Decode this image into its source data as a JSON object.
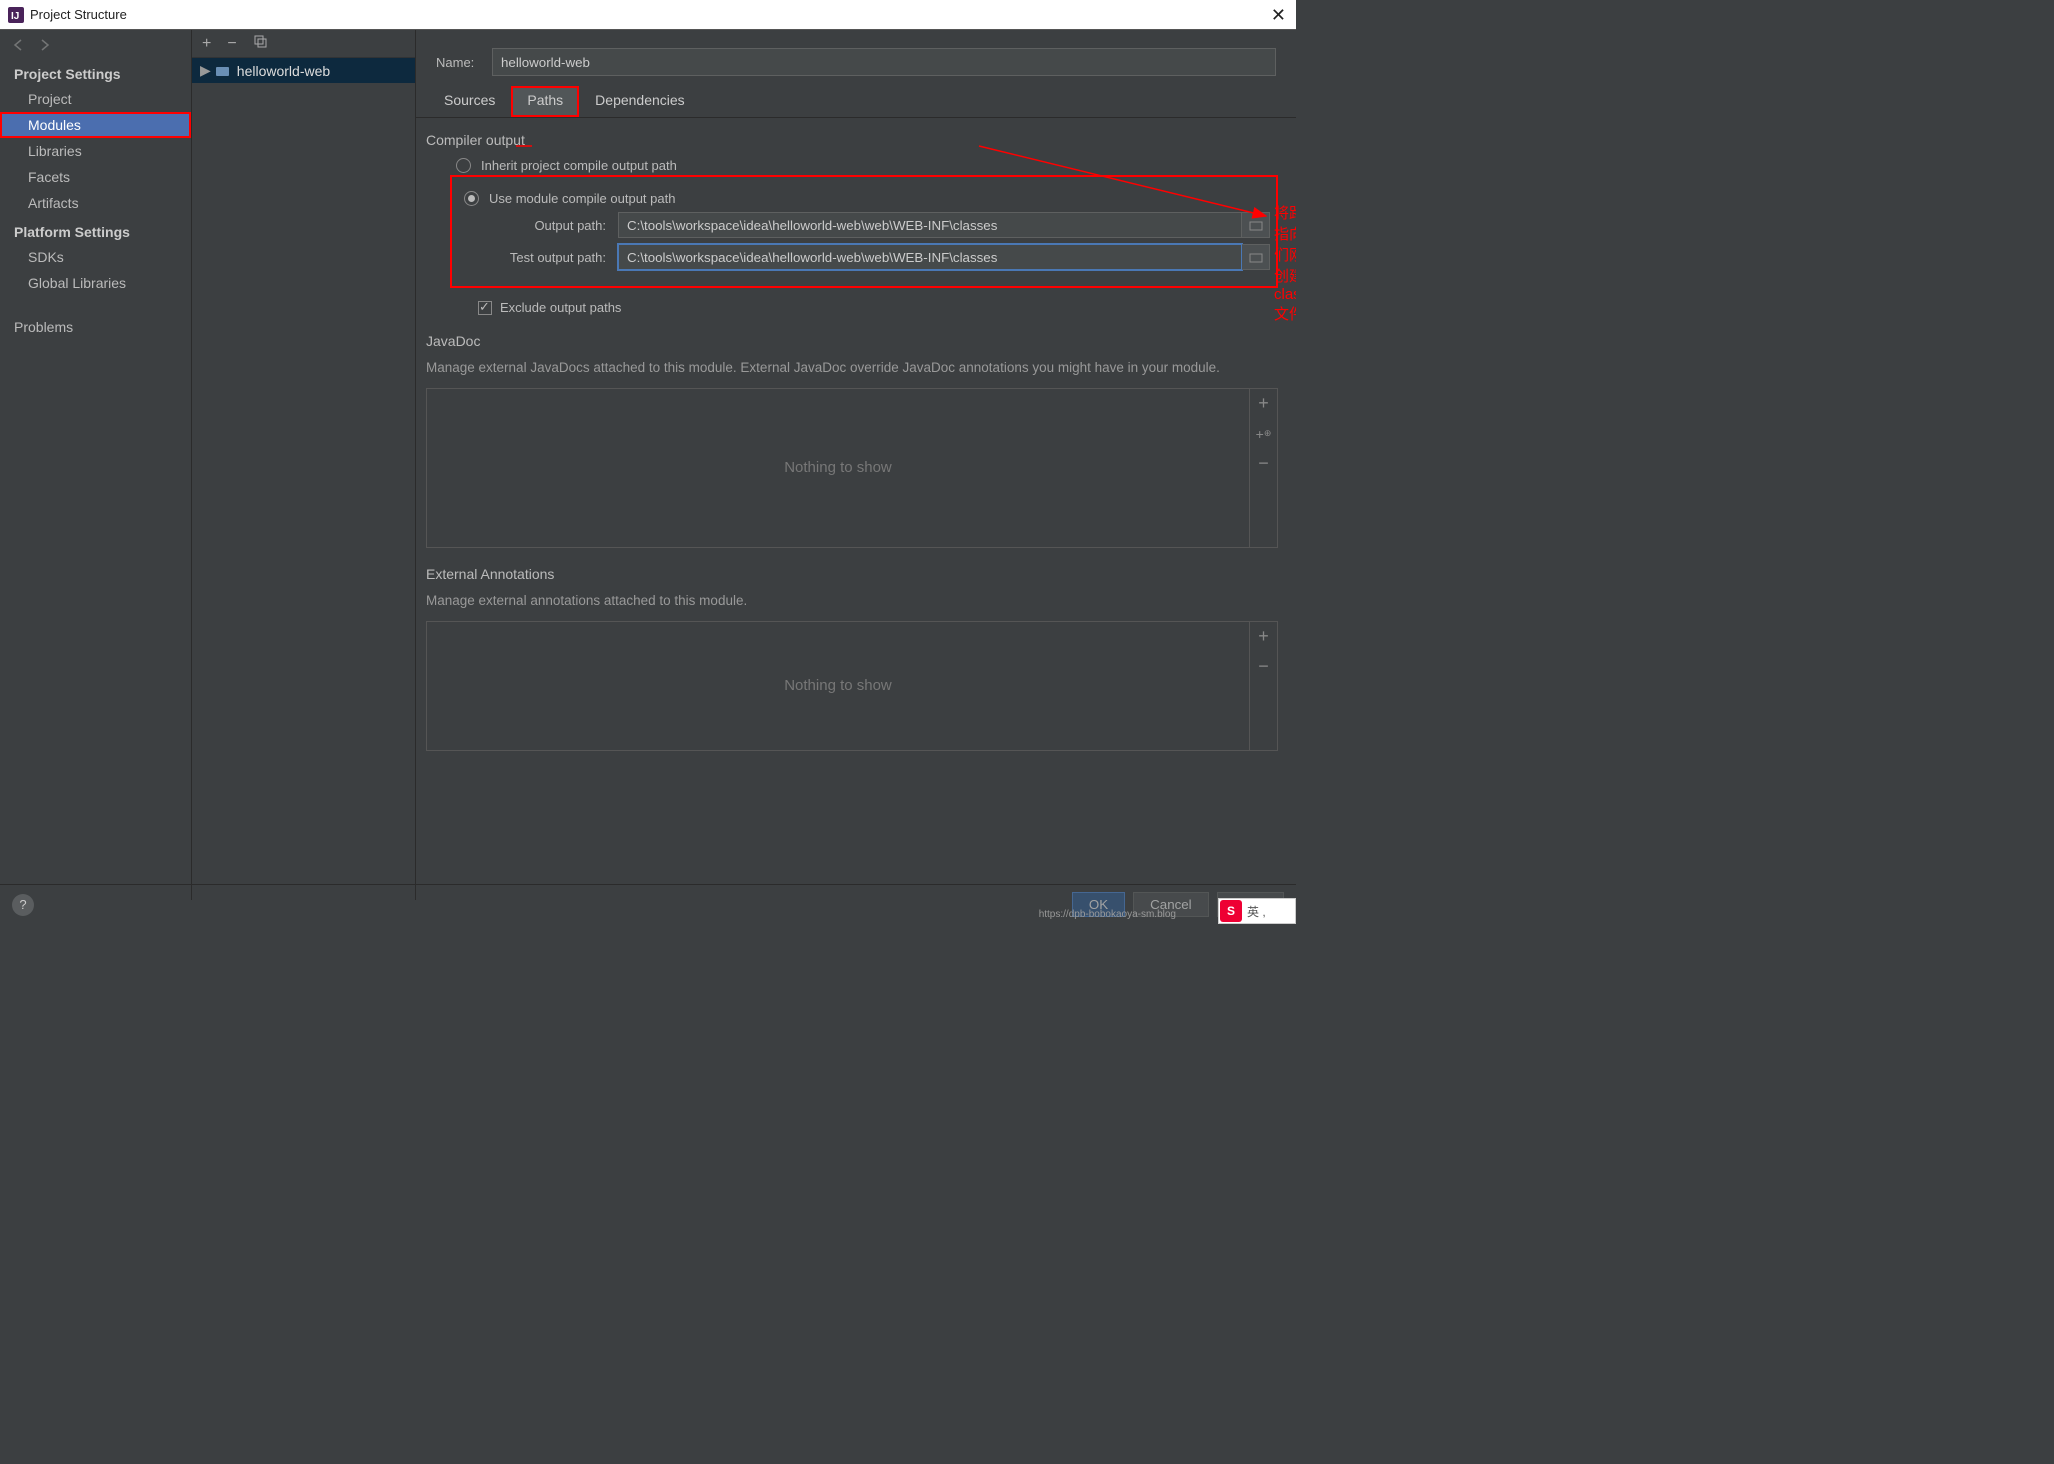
{
  "window": {
    "title": "Project Structure"
  },
  "leftnav": {
    "section1": "Project Settings",
    "items1": [
      "Project",
      "Modules",
      "Libraries",
      "Facets",
      "Artifacts"
    ],
    "section2": "Platform Settings",
    "items2": [
      "SDKs",
      "Global Libraries"
    ],
    "section3": "",
    "items3": [
      "Problems"
    ]
  },
  "module_tree": {
    "item": "helloworld-web"
  },
  "name_field": {
    "label": "Name:",
    "value": "helloworld-web"
  },
  "tabs": {
    "sources": "Sources",
    "paths": "Paths",
    "dependencies": "Dependencies"
  },
  "compiler": {
    "section": "Compiler output",
    "radio_inherit": "Inherit project compile output path",
    "radio_module": "Use module compile output path",
    "output_label": "Output path:",
    "output_value": "C:\\tools\\workspace\\idea\\helloworld-web\\web\\WEB-INF\\classes",
    "test_label": "Test output path:",
    "test_value": "C:\\tools\\workspace\\idea\\helloworld-web\\web\\WEB-INF\\classes",
    "exclude": "Exclude output paths"
  },
  "javadoc": {
    "title": "JavaDoc",
    "desc": "Manage external JavaDocs attached to this module. External JavaDoc override JavaDoc annotations you might have in your module.",
    "empty": "Nothing to show"
  },
  "extannot": {
    "title": "External Annotations",
    "desc": "Manage external annotations attached to this module.",
    "empty": "Nothing to show"
  },
  "annotation": "将路径指向我们刚刚创建的classes文件夹",
  "buttons": {
    "ok": "OK",
    "cancel": "Cancel",
    "apply": "Apply"
  },
  "watermark": "https://dpb-bobokaoya-sm.blog",
  "ime": "英 ,"
}
